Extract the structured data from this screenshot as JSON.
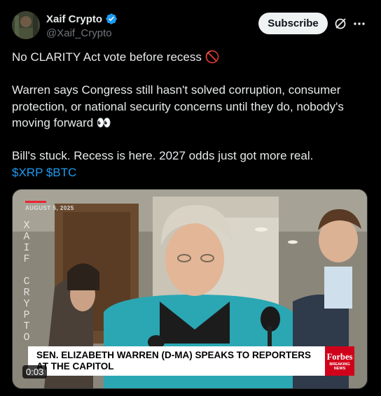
{
  "author": {
    "display_name": "Xaif Crypto",
    "handle": "@Xaif_Crypto",
    "verified": true
  },
  "actions": {
    "subscribe_label": "Subscribe",
    "grok_icon": "grok-slash-icon",
    "more_icon": "more-dots-icon"
  },
  "post": {
    "line1": "No CLARITY Act vote before recess 🚫",
    "line2": "Warren says Congress still hasn't solved corruption, consumer protection, or national security concerns until they do, nobody's moving forward 👀",
    "line3": "Bill's stuck. Recess is here. 2027 odds just got more real.",
    "cashtag1": "$XRP",
    "cashtag2": "$BTC"
  },
  "media": {
    "date": "AUGUST 5, 2025",
    "watermark": "XAIF CRYPTO",
    "chyron": "SEN. ELIZABETH WARREN (D-MA) SPEAKS TO REPORTERS AT THE CAPITOL",
    "logo_name": "Forbes",
    "logo_sub1": "BREAKING",
    "logo_sub2": "NEWS",
    "duration": "0:03"
  },
  "colors": {
    "background": "#000000",
    "text": "#e7e9ea",
    "secondary": "#71767b",
    "link": "#1d9bf0",
    "verified": "#1d9bf0"
  }
}
